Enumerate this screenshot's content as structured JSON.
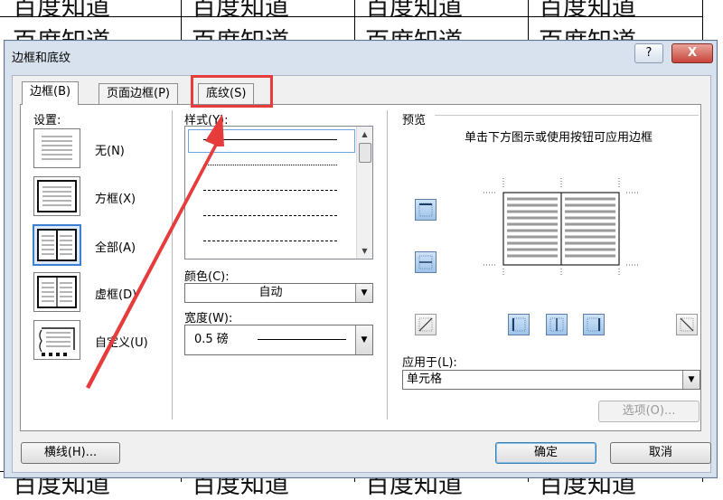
{
  "background_doc": {
    "cells": [
      {
        "col": 0,
        "row": 0,
        "text": "百度知道"
      },
      {
        "col": 1,
        "row": 0,
        "text": "百度知道"
      },
      {
        "col": 2,
        "row": 0,
        "text": "百度知道"
      },
      {
        "col": 3,
        "row": 0,
        "text": "百度知道"
      },
      {
        "col": 0,
        "row": 1,
        "text": "百度知道"
      },
      {
        "col": 1,
        "row": 1,
        "text": "百度知道"
      },
      {
        "col": 2,
        "row": 1,
        "text": "百度知道"
      },
      {
        "col": 3,
        "row": 1,
        "text": "百度知道"
      },
      {
        "col": 0,
        "row": 2,
        "text": "百度知道"
      },
      {
        "col": 1,
        "row": 2,
        "text": "百度知道"
      },
      {
        "col": 2,
        "row": 2,
        "text": "百度知道"
      },
      {
        "col": 3,
        "row": 2,
        "text": "百度知道"
      }
    ]
  },
  "dialog": {
    "title": "边框和底纹",
    "help_label": "?",
    "close_label": "X",
    "tabs": [
      {
        "label": "边框(B)",
        "active": true
      },
      {
        "label": "页面边框(P)",
        "active": false
      },
      {
        "label": "底纹(S)",
        "active": false
      }
    ],
    "settings": {
      "heading": "设置:",
      "presets": [
        {
          "label": "无(N)"
        },
        {
          "label": "方框(X)"
        },
        {
          "label": "全部(A)",
          "selected": true
        },
        {
          "label": "虚框(D)"
        },
        {
          "label": "自定义(U)"
        }
      ]
    },
    "style": {
      "heading": "样式(Y):",
      "color_label": "颜色(C):",
      "color_value": "自动",
      "width_label": "宽度(W):",
      "width_value": "0.5 磅"
    },
    "preview": {
      "heading": "预览",
      "hint": "单击下方图示或使用按钮可应用边框",
      "apply_label": "应用于(L):",
      "apply_value": "单元格",
      "options_button": "选项(O)..."
    },
    "footer": {
      "hline_button": "横线(H)...",
      "ok_button": "确定",
      "cancel_button": "取消"
    }
  },
  "colors": {
    "annotation": "#e63c3c",
    "accent": "#3d7fd1"
  }
}
